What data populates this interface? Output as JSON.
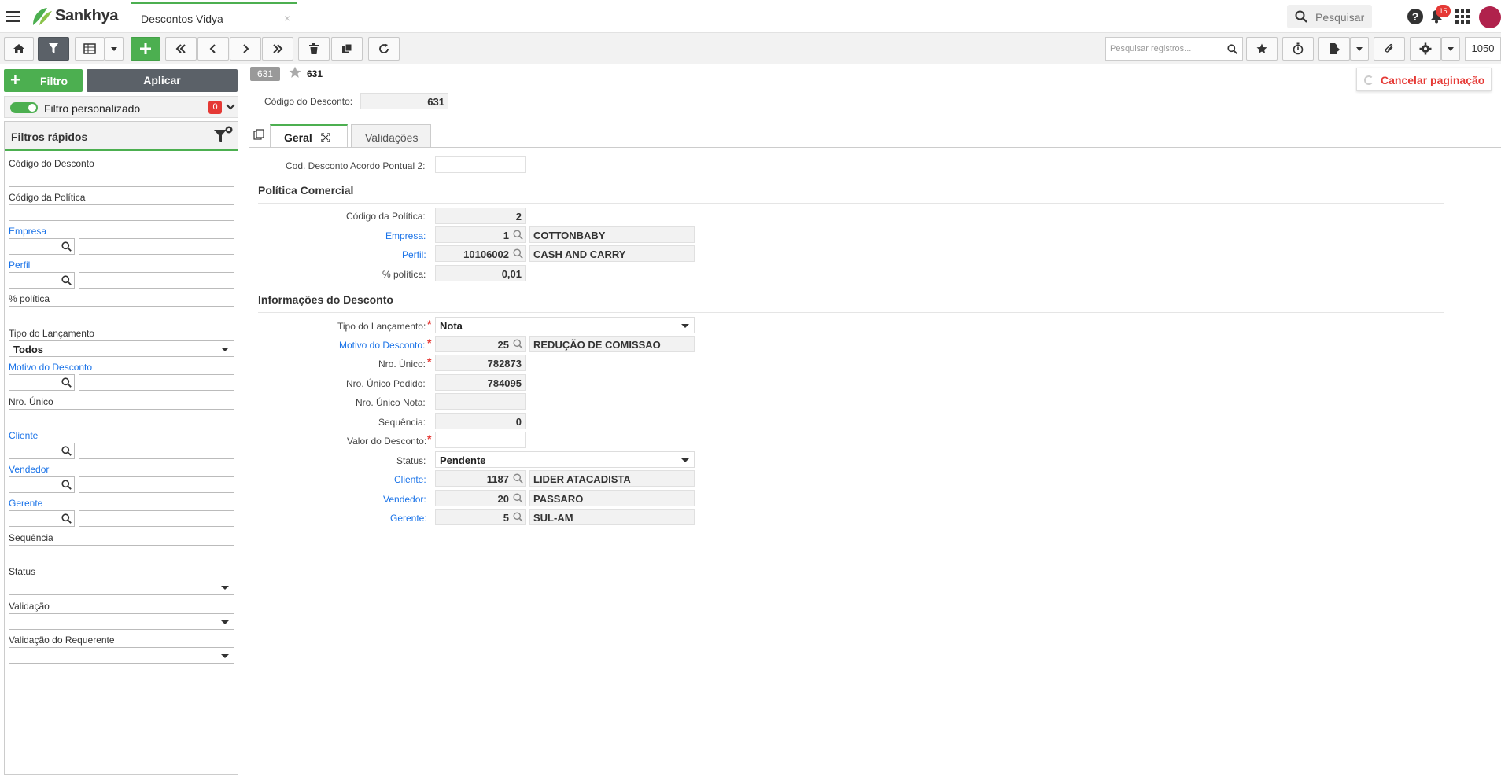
{
  "app": {
    "brand": "Sankhya",
    "tab_title": "Descontos Vidya",
    "tab_close": "×"
  },
  "topbar": {
    "search_placeholder": "Pesquisar",
    "notification_count": "15",
    "help": "?"
  },
  "toolbar": {
    "search_records_placeholder": "Pesquisar registros...",
    "page_size": "1050"
  },
  "left": {
    "filtro_label": "Filtro",
    "aplicar_label": "Aplicar",
    "filtro_personalizado": "Filtro personalizado",
    "filtro_personalizado_count": "0",
    "quick_filters_title": "Filtros rápidos",
    "fields": {
      "codigo_desconto": "Código do Desconto",
      "codigo_politica": "Código da Política",
      "empresa": "Empresa",
      "perfil": "Perfil",
      "pct_politica": "% política",
      "tipo_lancamento": "Tipo do Lançamento",
      "tipo_lancamento_value": "Todos",
      "motivo_desconto": "Motivo do Desconto",
      "nro_unico": "Nro. Único",
      "cliente": "Cliente",
      "vendedor": "Vendedor",
      "gerente": "Gerente",
      "sequencia": "Sequência",
      "status": "Status",
      "validacao": "Validação",
      "validacao_requerente": "Validação do Requerente"
    }
  },
  "record": {
    "pill": "631",
    "number": "631",
    "cancel_pagination": "Cancelar paginação",
    "codigo_desconto_label": "Código do Desconto:",
    "codigo_desconto_value": "631"
  },
  "tabs": {
    "geral": "Geral",
    "validacoes": "Validações"
  },
  "form": {
    "cod_acordo_label": "Cod. Desconto Acordo Pontual 2:",
    "politica_section": "Política Comercial",
    "codigo_politica_label": "Código da Política:",
    "codigo_politica_value": "2",
    "empresa_label": "Empresa:",
    "empresa_code": "1",
    "empresa_name": "COTTONBABY",
    "perfil_label": "Perfil:",
    "perfil_code": "10106002",
    "perfil_name": "CASH AND CARRY",
    "pct_politica_label": "% política:",
    "pct_politica_value": "0,01",
    "info_section": "Informações do Desconto",
    "tipo_lancamento_label": "Tipo do Lançamento:",
    "tipo_lancamento_value": "Nota",
    "motivo_label": "Motivo do Desconto:",
    "motivo_code": "25",
    "motivo_name": "REDUÇÃO DE COMISSAO",
    "nro_unico_label": "Nro. Único:",
    "nro_unico_value": "782873",
    "nro_unico_pedido_label": "Nro. Único Pedido:",
    "nro_unico_pedido_value": "784095",
    "nro_unico_nota_label": "Nro. Único Nota:",
    "sequencia_label": "Sequência:",
    "sequencia_value": "0",
    "valor_desconto_label": "Valor do Desconto:",
    "status_label": "Status:",
    "status_value": "Pendente",
    "cliente_label": "Cliente:",
    "cliente_code": "1187",
    "cliente_name": "LIDER ATACADISTA",
    "vendedor_label": "Vendedor:",
    "vendedor_code": "20",
    "vendedor_name": "PASSARO",
    "gerente_label": "Gerente:",
    "gerente_code": "5",
    "gerente_name": "SUL-AM"
  },
  "colors": {
    "accent": "#4caf50",
    "dark": "#5b6168",
    "link": "#1a73e8",
    "danger": "#e53935"
  }
}
